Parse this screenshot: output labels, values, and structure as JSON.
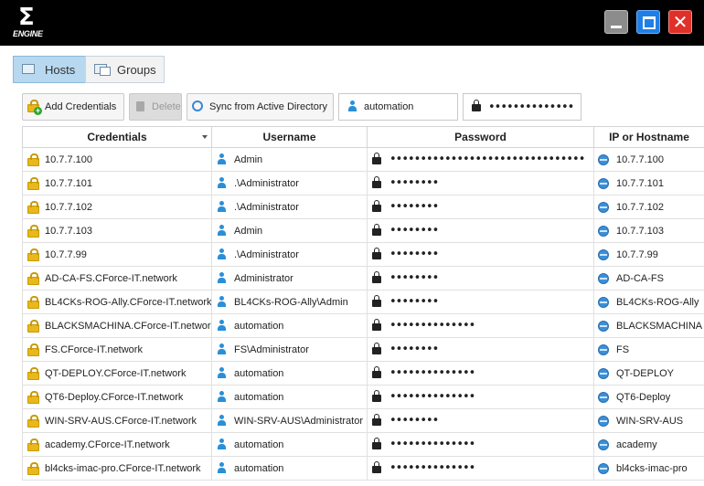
{
  "app": {
    "logo_text": "ENGINE"
  },
  "tabs": [
    {
      "label": "Hosts",
      "selected": true
    },
    {
      "label": "Groups",
      "selected": false
    }
  ],
  "toolbar": {
    "add_label": "Add Credentials",
    "delete_label": "Delete",
    "sync_label": "Sync from Active Directory",
    "username_value": "automation",
    "password_value": "••••••••••••••"
  },
  "table": {
    "columns": [
      "Credentials",
      "Username",
      "Password",
      "IP or Hostname"
    ],
    "rows": [
      [
        "10.7.7.100",
        "Admin",
        "••••••••••••••••••••••••••••••••",
        "10.7.7.100"
      ],
      [
        "10.7.7.101",
        ".\\Administrator",
        "••••••••",
        "10.7.7.101"
      ],
      [
        "10.7.7.102",
        ".\\Administrator",
        "••••••••",
        "10.7.7.102"
      ],
      [
        "10.7.7.103",
        "Admin",
        "••••••••",
        "10.7.7.103"
      ],
      [
        "10.7.7.99",
        ".\\Administrator",
        "••••••••",
        "10.7.7.99"
      ],
      [
        "AD-CA-FS.CForce-IT.network",
        "Administrator",
        "••••••••",
        "AD-CA-FS"
      ],
      [
        "BL4CKs-ROG-Ally.CForce-IT.network",
        "BL4CKs-ROG-Ally\\Admin",
        "••••••••",
        "BL4CKs-ROG-Ally"
      ],
      [
        "BLACKSMACHINA.CForce-IT.network",
        "automation",
        "••••••••••••••",
        "BLACKSMACHINA"
      ],
      [
        "FS.CForce-IT.network",
        "FS\\Administrator",
        "••••••••",
        "FS"
      ],
      [
        "QT-DEPLOY.CForce-IT.network",
        "automation",
        "••••••••••••••",
        "QT-DEPLOY"
      ],
      [
        "QT6-Deploy.CForce-IT.network",
        "automation",
        "••••••••••••••",
        "QT6-Deploy"
      ],
      [
        "WIN-SRV-AUS.CForce-IT.network",
        "WIN-SRV-AUS\\Administrator",
        "••••••••",
        "WIN-SRV-AUS"
      ],
      [
        "academy.CForce-IT.network",
        "automation",
        "••••••••••••••",
        "academy"
      ],
      [
        "bl4cks-imac-pro.CForce-IT.network",
        "automation",
        "••••••••••••••",
        "bl4cks-imac-pro"
      ]
    ]
  }
}
